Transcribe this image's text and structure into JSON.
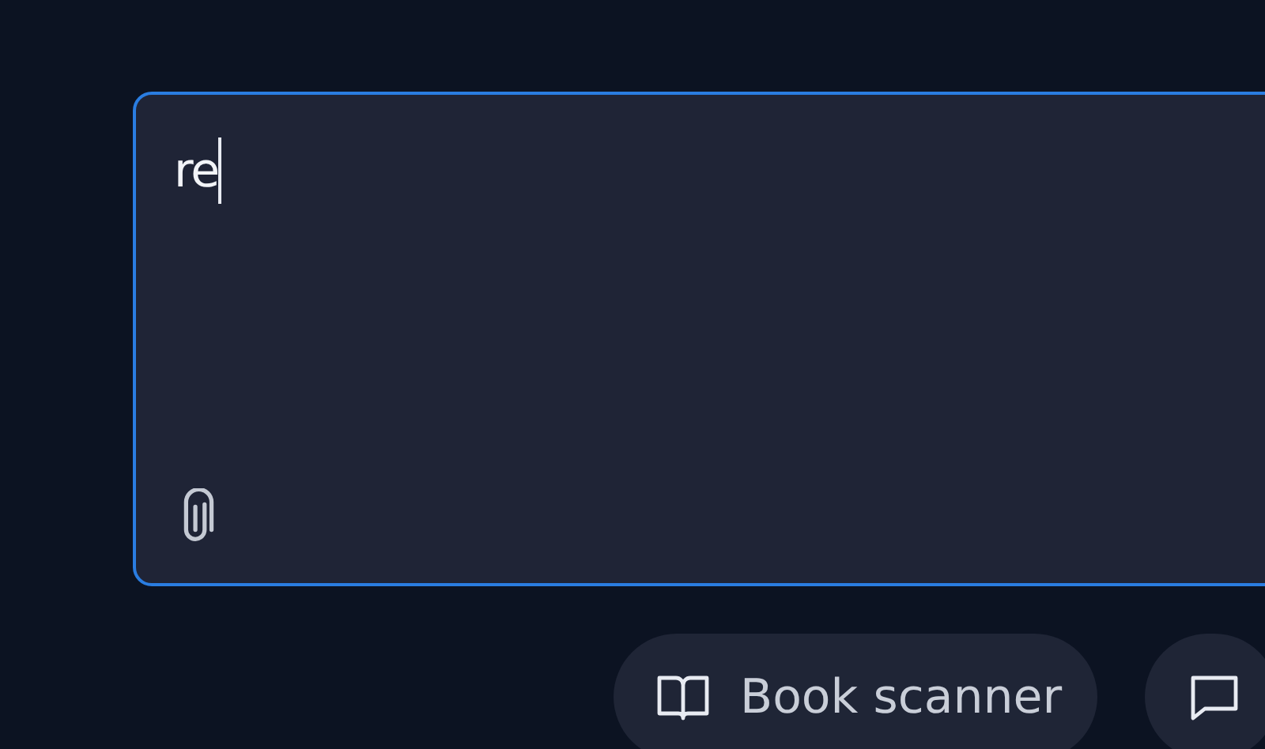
{
  "composer": {
    "value": "re",
    "focused": true
  },
  "chips": [
    {
      "kind": "book",
      "label": "Book scanner"
    },
    {
      "kind": "chat"
    }
  ]
}
